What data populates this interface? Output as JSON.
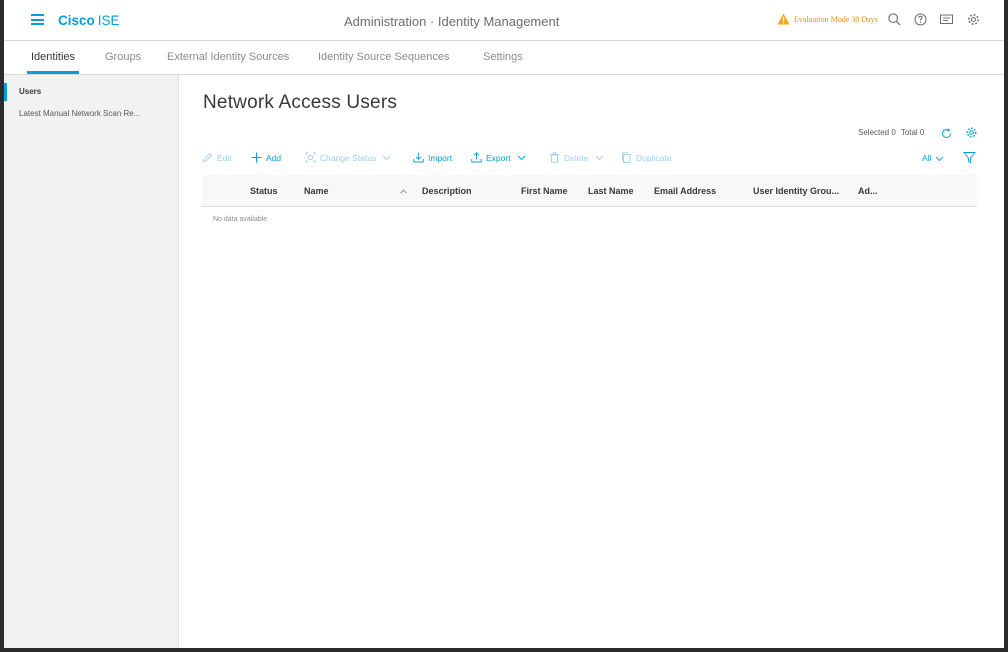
{
  "header": {
    "brand": "Cisco",
    "brand_suffix": "ISE",
    "page_heading": "Administration · Identity Management",
    "evaluation_text": "Evaluation Mode 30 Days",
    "icons": [
      "menu-icon",
      "warning-icon",
      "search-icon",
      "help-icon",
      "notifications-icon",
      "settings-icon"
    ]
  },
  "tabs": [
    {
      "label": "Identities",
      "active": true
    },
    {
      "label": "Groups"
    },
    {
      "label": "External Identity Sources"
    },
    {
      "label": "Identity Source Sequences"
    },
    {
      "label": "Settings"
    }
  ],
  "sidebar": {
    "items": [
      {
        "label": "Users",
        "active": true
      },
      {
        "label": "Latest Manual Network Scan Re..."
      }
    ]
  },
  "main": {
    "title": "Network Access Users",
    "selected_label": "Selected 0",
    "total_label": "Total 0",
    "toolbar": {
      "edit": "Edit",
      "add": "Add",
      "change_status": "Change Status",
      "import": "Import",
      "export": "Export",
      "delete": "Delete",
      "duplicate": "Duplicate",
      "filter_all": "All"
    },
    "table": {
      "columns": [
        "Status",
        "Name",
        "Description",
        "First Name",
        "Last Name",
        "Email Address",
        "User Identity Grou...",
        "Ad..."
      ],
      "empty_message": "No data available"
    }
  },
  "colors": {
    "accent": "#049fd9",
    "warning": "#e2901c",
    "sidebar_bg": "#f2f2f2"
  }
}
